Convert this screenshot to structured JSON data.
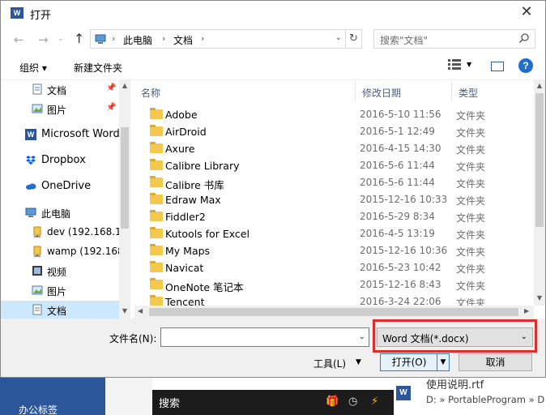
{
  "window": {
    "title": "打开",
    "icon": "word-icon",
    "close": "✕"
  },
  "nav": {
    "back": "←",
    "forward": "→",
    "up": "↑",
    "breadcrumb": [
      "此电脑",
      "文档"
    ],
    "separator": "›",
    "refresh": "↻",
    "search_placeholder": "搜索\"文档\""
  },
  "toolbar": {
    "organize": "组织 ▾",
    "new_folder": "新建文件夹",
    "help": "?"
  },
  "sidebar": {
    "items": [
      {
        "label": "文档",
        "icon": "document-icon",
        "pinned": true
      },
      {
        "label": "图片",
        "icon": "pictures-icon",
        "pinned": true
      },
      {
        "label": "Microsoft Word",
        "icon": "word-icon"
      },
      {
        "label": "Dropbox",
        "icon": "dropbox-icon"
      },
      {
        "label": "OneDrive",
        "icon": "onedrive-icon"
      },
      {
        "label": "此电脑",
        "icon": "computer-icon"
      },
      {
        "label": "dev (192.168.1.",
        "icon": "network-drive-icon"
      },
      {
        "label": "wamp (192.168",
        "icon": "network-drive-icon"
      },
      {
        "label": "视频",
        "icon": "video-icon"
      },
      {
        "label": "图片",
        "icon": "pictures-icon"
      },
      {
        "label": "文档",
        "icon": "document-icon",
        "selected": true
      }
    ]
  },
  "columns": {
    "name": "名称",
    "date": "修改日期",
    "type": "类型"
  },
  "files": [
    {
      "name": "Adobe",
      "date": "2016-5-10 11:56",
      "type": "文件夹"
    },
    {
      "name": "AirDroid",
      "date": "2016-5-1 12:49",
      "type": "文件夹"
    },
    {
      "name": "Axure",
      "date": "2016-4-15 14:30",
      "type": "文件夹"
    },
    {
      "name": "Calibre Library",
      "date": "2016-5-6 11:44",
      "type": "文件夹"
    },
    {
      "name": "Calibre 书库",
      "date": "2016-5-6 11:44",
      "type": "文件夹"
    },
    {
      "name": "Edraw Max",
      "date": "2015-12-16 10:33",
      "type": "文件夹"
    },
    {
      "name": "Fiddler2",
      "date": "2016-5-29 8:34",
      "type": "文件夹"
    },
    {
      "name": "Kutools for Excel",
      "date": "2016-4-5 13:19",
      "type": "文件夹"
    },
    {
      "name": "My Maps",
      "date": "2015-12-16 10:36",
      "type": "文件夹"
    },
    {
      "name": "Navicat",
      "date": "2016-5-23 10:42",
      "type": "文件夹"
    },
    {
      "name": "OneNote 笔记本",
      "date": "2015-12-16 8:43",
      "type": "文件夹"
    },
    {
      "name": "Tencent",
      "date": "2016-3-24 22:06",
      "type": "文件夹"
    }
  ],
  "bottom": {
    "filename_label": "文件名(N):",
    "filename_value": "",
    "filter": "Word 文档(*.docx)",
    "tools": "工具(L)",
    "open": "打开(O)",
    "cancel": "取消"
  },
  "background": {
    "left_label": "办公标签",
    "taskbar_search": "搜索",
    "recent_name": "使用说明.rtf",
    "recent_path": "D: » PortableProgram » D"
  },
  "colors": {
    "accent": "#1f6fcf",
    "selection": "#cce8ff",
    "highlight": "#d9302c",
    "word_blue": "#2b579a"
  }
}
